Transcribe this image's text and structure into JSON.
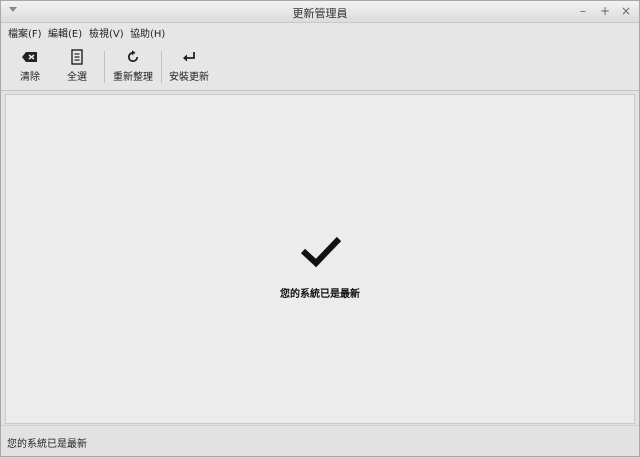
{
  "window": {
    "title": "更新管理員"
  },
  "window_controls": {
    "minimize": "–",
    "maximize": "+",
    "close": "×"
  },
  "menubar": {
    "items": [
      {
        "label": "檔案(F)"
      },
      {
        "label": "編輯(E)"
      },
      {
        "label": "檢視(V)"
      },
      {
        "label": "協助(H)"
      }
    ]
  },
  "toolbar": {
    "clear_label": "清除",
    "select_all_label": "全選",
    "refresh_label": "重新整理",
    "install_label": "安裝更新"
  },
  "icons": {
    "clear": "backspace-icon",
    "select_all": "document-list-icon",
    "refresh": "refresh-icon",
    "install": "enter-arrow-icon",
    "status": "checkmark-icon"
  },
  "main": {
    "status_message": "您的系統已是最新"
  },
  "statusbar": {
    "text": "您的系統已是最新"
  }
}
